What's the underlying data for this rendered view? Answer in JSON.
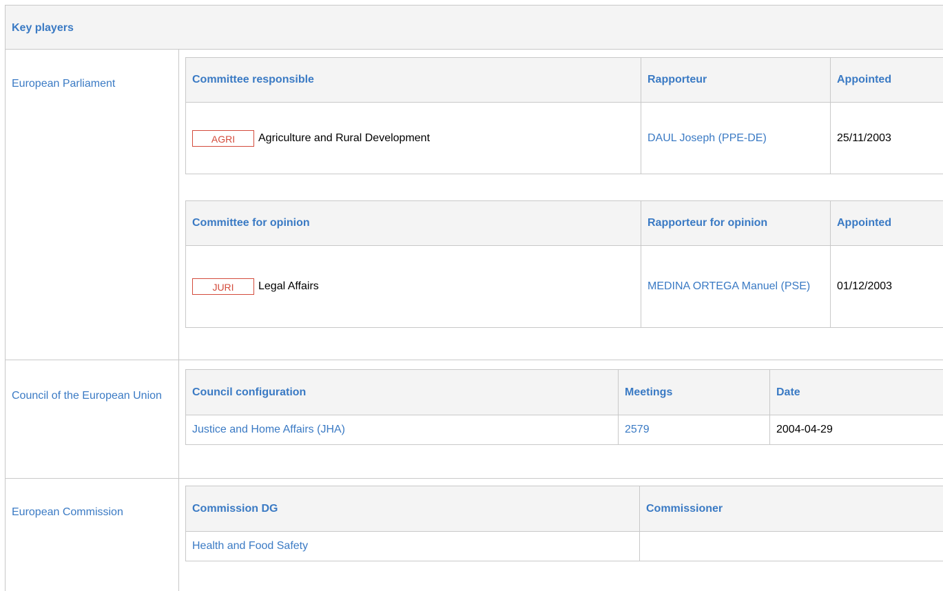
{
  "header": {
    "title": "Key players"
  },
  "parliament": {
    "label": "European Parliament",
    "responsible": {
      "col_committee": "Committee responsible",
      "col_rapporteur": "Rapporteur",
      "col_appointed": "Appointed",
      "rows": [
        {
          "code": "AGRI",
          "name": "Agriculture and Rural Development",
          "rapporteur": "DAUL Joseph (PPE-DE)",
          "appointed": "25/11/2003"
        }
      ]
    },
    "opinion": {
      "col_committee": "Committee for opinion",
      "col_rapporteur": "Rapporteur for opinion",
      "col_appointed": "Appointed",
      "rows": [
        {
          "code": "JURI",
          "name": "Legal Affairs",
          "rapporteur": "MEDINA ORTEGA Manuel (PSE)",
          "appointed": "01/12/2003"
        }
      ]
    }
  },
  "council": {
    "label": "Council of the European Union",
    "col_configuration": "Council configuration",
    "col_meetings": "Meetings",
    "col_date": "Date",
    "rows": [
      {
        "configuration": "Justice and Home Affairs (JHA)",
        "meetings": "2579",
        "date": "2004-04-29"
      }
    ]
  },
  "commission": {
    "label": "European Commission",
    "col_dg": "Commission DG",
    "col_commissioner": "Commissioner",
    "rows": [
      {
        "dg": "Health and Food Safety",
        "commissioner": ""
      }
    ]
  },
  "colors": {
    "link": "#3a7ac4",
    "badge": "#d34a3a",
    "header_bg": "#f4f4f4",
    "border": "#c8c8c8"
  }
}
